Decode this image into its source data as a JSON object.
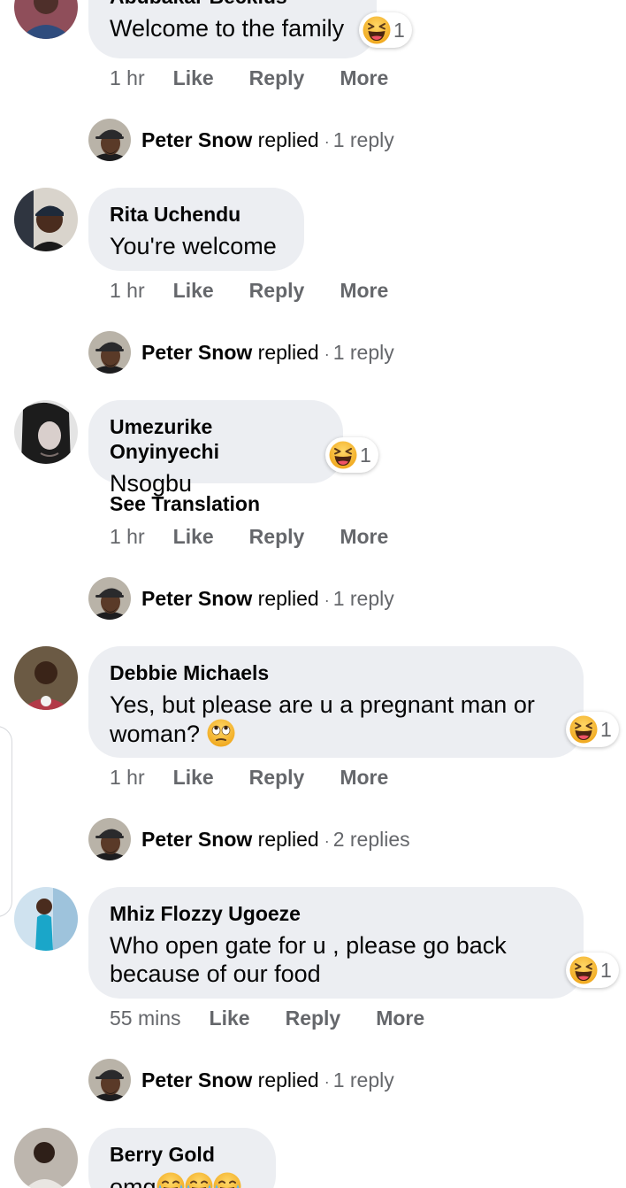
{
  "comments": [
    {
      "author": "Abubakar Beckius",
      "text": "Welcome to the family",
      "reaction": {
        "icon": "laughing-emoji",
        "count": "1"
      },
      "time": "1 hr",
      "actions": [
        "Like",
        "Reply",
        "More"
      ],
      "reply_summary": {
        "name": "Peter Snow",
        "verb": "replied",
        "dot": "·",
        "count": "1 reply"
      }
    },
    {
      "author": "Rita Uchendu",
      "text": "You're welcome",
      "time": "1 hr",
      "actions": [
        "Like",
        "Reply",
        "More"
      ],
      "reply_summary": {
        "name": "Peter Snow",
        "verb": "replied",
        "dot": "·",
        "count": "1 reply"
      }
    },
    {
      "author": "Umezurike Onyinyechi",
      "text": "Nsogbu",
      "reaction": {
        "icon": "laughing-emoji",
        "count": "1"
      },
      "see_translation": "See Translation",
      "time": "1 hr",
      "actions": [
        "Like",
        "Reply",
        "More"
      ],
      "reply_summary": {
        "name": "Peter Snow",
        "verb": "replied",
        "dot": "·",
        "count": "1 reply"
      }
    },
    {
      "author": "Debbie Michaels",
      "text_line1": "Yes, but please are u a pregnant man or",
      "text_line2": "woman?",
      "inline_emoji": "eye-roll-emoji",
      "reaction": {
        "icon": "laughing-emoji",
        "count": "1"
      },
      "time": "1 hr",
      "actions": [
        "Like",
        "Reply",
        "More"
      ],
      "reply_summary": {
        "name": "Peter Snow",
        "verb": "replied",
        "dot": "·",
        "count": "2 replies"
      }
    },
    {
      "author": "Mhiz Flozzy Ugoeze",
      "text_line1": "Who open gate for u , please go back",
      "text_line2": "because of our food",
      "reaction": {
        "icon": "laughing-emoji",
        "count": "1"
      },
      "time": "55 mins",
      "actions": [
        "Like",
        "Reply",
        "More"
      ],
      "reply_summary": {
        "name": "Peter Snow",
        "verb": "replied",
        "dot": "·",
        "count": "1 reply"
      }
    },
    {
      "author": "Berry Gold",
      "text": "omg",
      "inline_emojis": [
        "tears-of-joy-emoji",
        "tears-of-joy-emoji",
        "tears-of-joy-emoji"
      ]
    }
  ],
  "colors": {
    "bubble": "#eceef2",
    "meta_text": "#65676b",
    "primary_text": "#050505",
    "emoji_yellow": "#f7b125"
  }
}
